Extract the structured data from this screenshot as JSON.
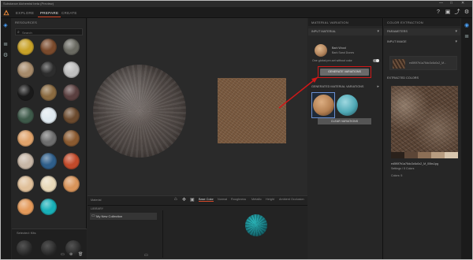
{
  "window": {
    "title": "Substance Alchemist beta (Preview)",
    "controls": [
      "—",
      "□",
      "✕"
    ]
  },
  "menu": {
    "tabs": [
      {
        "label": "EXPLORE",
        "active": false
      },
      {
        "label": "PREPARE",
        "active": true
      },
      {
        "label": "CREATE",
        "active": false
      }
    ],
    "right_icons": [
      "help-icon",
      "screenshot-icon",
      "share-icon",
      "settings-icon"
    ]
  },
  "resources": {
    "title": "RESOURCES",
    "search_placeholder": "Search",
    "materials": [
      {
        "name": "gold",
        "color": "#c9a227"
      },
      {
        "name": "brown-leather",
        "color": "#7a4a2c"
      },
      {
        "name": "stone-gray",
        "color": "#6a6a62"
      },
      {
        "name": "carved-stone",
        "color": "#a68a6a"
      },
      {
        "name": "dark-metal",
        "color": "#2d2d2d"
      },
      {
        "name": "cracked-marble",
        "color": "#bdbdbd"
      },
      {
        "name": "black-rubber",
        "color": "#1a1a1a"
      },
      {
        "name": "bronze",
        "color": "#8a6a40"
      },
      {
        "name": "brown-velvet",
        "color": "#5a3f3f"
      },
      {
        "name": "green-paint",
        "color": "#3e5a4a"
      },
      {
        "name": "white-plaster",
        "color": "#dfe9ef"
      },
      {
        "name": "bark",
        "color": "#6b4a2e"
      },
      {
        "name": "sand",
        "color": "#e0a36b"
      },
      {
        "name": "granite",
        "color": "#6e6e6e"
      },
      {
        "name": "wood",
        "color": "#8a5a30"
      },
      {
        "name": "wave-fabric",
        "color": "#c7b6a6"
      },
      {
        "name": "blue-plastic",
        "color": "#2e5e8a"
      },
      {
        "name": "red-rust",
        "color": "#c24a2a"
      },
      {
        "name": "peach-fabric",
        "color": "#e0c09a"
      },
      {
        "name": "ivory",
        "color": "#e8d8b8"
      },
      {
        "name": "tan-skin",
        "color": "#d8945a"
      },
      {
        "name": "orange-skin",
        "color": "#e49a5a"
      },
      {
        "name": "teal-mosaic",
        "color": "#18b0b8"
      }
    ],
    "bottom_title": "Selected: Kits"
  },
  "viewport": {
    "status": "Material",
    "tabs": [
      {
        "label": "Base Color",
        "active": true
      },
      {
        "label": "Normal",
        "active": false
      },
      {
        "label": "Roughness",
        "active": false
      },
      {
        "label": "Metallic",
        "active": false
      },
      {
        "label": "Height",
        "active": false
      },
      {
        "label": "Ambient Occlusion",
        "active": false
      }
    ]
  },
  "library": {
    "title": "LIBRARY",
    "collection_label": "My New Collection"
  },
  "material_variation": {
    "title": "MATERIAL VARIATION",
    "input_section": "INPUT MATERIAL",
    "material_name": "Bark Wood",
    "material_sub": "Bark Sand Dunes",
    "toggle_label": "One global pre-set without color",
    "generate_label": "GENERATE VARIATIONS",
    "variations_section": "GENERATED MATERIAL VARIATIONS",
    "clear_label": "CLEAR VARIATIONS",
    "variations": [
      {
        "name": "variation-brown",
        "color": "#b48052"
      },
      {
        "name": "variation-teal",
        "color": "#4fa9b6"
      }
    ]
  },
  "color_extraction": {
    "title": "COLOR EXTRACTION",
    "params_section": "PARAMETERS",
    "input_image_section": "INPUT IMAGE",
    "input_image_name": "ed5f0f7b1a76dc3c6c0c2_M...",
    "extracted_section": "EXTRACTED COLORS",
    "palette": [
      "#2a211b",
      "#5c4637",
      "#8c6f56",
      "#b79c80",
      "#d8c6ae"
    ],
    "file_label": "ed5f0f7b1a76dc3c6c0c2_M_00bs1pg",
    "sub_label": "Settings / 5 Colors",
    "count_label": "Colors: 5"
  },
  "colors": {
    "accent": "#d84a2a",
    "highlight": "#d01818"
  }
}
